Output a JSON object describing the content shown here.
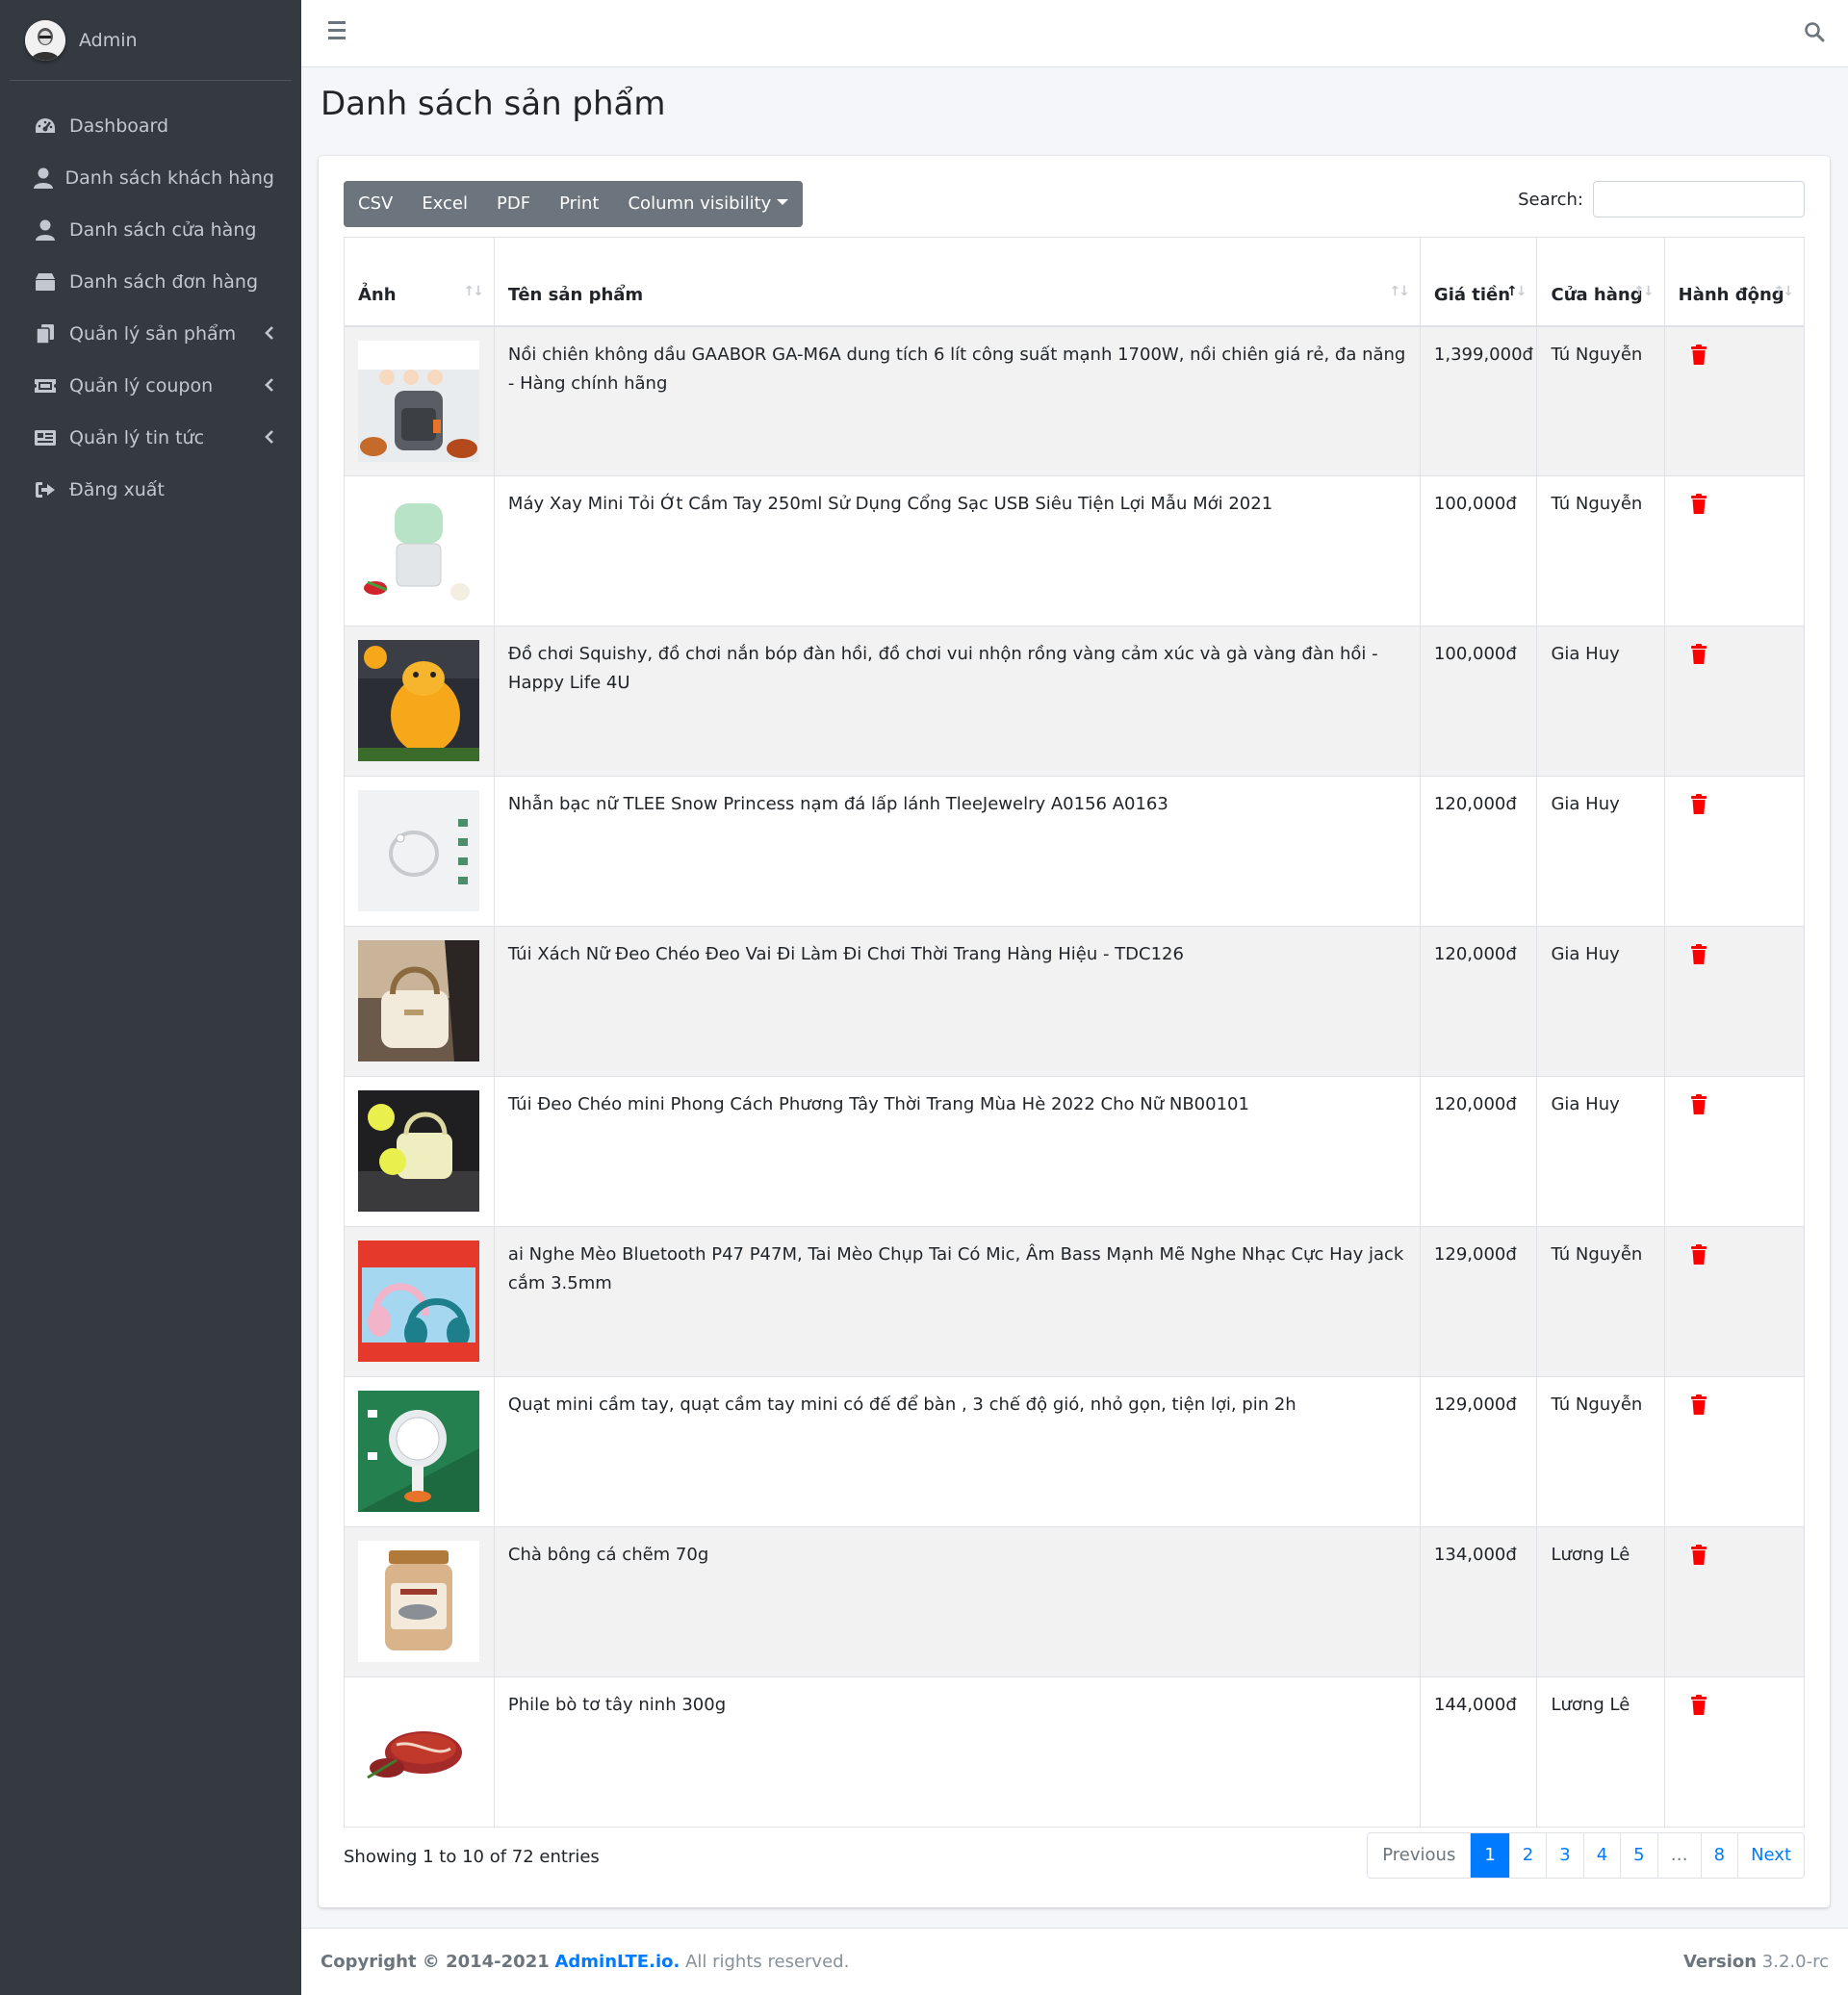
{
  "sidebar": {
    "user_name": "Admin",
    "items": [
      {
        "label": "Dashboard",
        "icon": "tachometer-icon",
        "caret": false
      },
      {
        "label": "Danh sách khách hàng",
        "icon": "user-icon",
        "caret": false
      },
      {
        "label": "Danh sách cửa hàng",
        "icon": "user-icon",
        "caret": false
      },
      {
        "label": "Danh sách đơn hàng",
        "icon": "box-icon",
        "caret": false
      },
      {
        "label": "Quản lý sản phẩm",
        "icon": "copy-icon",
        "caret": true
      },
      {
        "label": "Quản lý coupon",
        "icon": "ticket-icon",
        "caret": true
      },
      {
        "label": "Quản lý tin tức",
        "icon": "newspaper-icon",
        "caret": true
      },
      {
        "label": "Đăng xuất",
        "icon": "sign-out-icon",
        "caret": false
      }
    ]
  },
  "header": {
    "menu_icon": "hamburger-icon",
    "search_icon": "search-icon"
  },
  "page": {
    "title": "Danh sách sản phẩm"
  },
  "toolbar": {
    "buttons": [
      "CSV",
      "Excel",
      "PDF",
      "Print",
      "Column visibility"
    ],
    "search_label": "Search:",
    "search_value": ""
  },
  "table": {
    "columns": [
      "Ảnh",
      "Tên sản phẩm",
      "Giá tiền",
      "Cửa hàng",
      "Hành động"
    ],
    "sorted_column": "Giá tiền",
    "sort_direction": "ascending",
    "rows": [
      {
        "image": "air-fryer-thumbnail",
        "name": "Nồi chiên không dầu GAABOR GA-M6A dung tích 6 lít công suất mạnh 1700W, nồi chiên giá rẻ, đa năng - Hàng chính hãng",
        "price": "1,399,000đ",
        "store": "Tú Nguyễn"
      },
      {
        "image": "mini-blender-thumbnail",
        "name": "Máy Xay Mini Tỏi Ớt Cầm Tay 250ml Sử Dụng Cổng Sạc USB Siêu Tiện Lợi Mẫu Mới 2021",
        "price": "100,000đ",
        "store": "Tú Nguyễn"
      },
      {
        "image": "squishy-toy-thumbnail",
        "name": "Đồ chơi Squishy, đồ chơi nắn bóp đàn hồi, đồ chơi vui nhộn rồng vàng cảm xúc và gà vàng đàn hồi - Happy Life 4U",
        "price": "100,000đ",
        "store": "Gia Huy"
      },
      {
        "image": "silver-ring-thumbnail",
        "name": "Nhẫn bạc nữ TLEE Snow Princess nạm đá lấp lánh TleeJewelry A0156 A0163",
        "price": "120,000đ",
        "store": "Gia Huy"
      },
      {
        "image": "shoulder-bag-thumbnail",
        "name": "Túi Xách Nữ Đeo Chéo Đeo Vai Đi Làm Đi Chơi Thời Trang Hàng Hiệu - TDC126",
        "price": "120,000đ",
        "store": "Gia Huy"
      },
      {
        "image": "crossbody-bag-thumbnail",
        "name": "Túi Đeo Chéo mini Phong Cách Phương Tây Thời Trang Mùa Hè 2022 Cho Nữ NB00101",
        "price": "120,000đ",
        "store": "Gia Huy"
      },
      {
        "image": "cat-headphones-thumbnail",
        "name": "ai Nghe Mèo Bluetooth P47 P47M, Tai Mèo Chụp Tai Có Mic, Âm Bass Mạnh Mẽ Nghe Nhạc Cực Hay jack cắm 3.5mm",
        "price": "129,000đ",
        "store": "Tú Nguyễn"
      },
      {
        "image": "mini-fan-thumbnail",
        "name": "Quạt mini cầm tay, quạt cầm tay mini có đế để bàn , 3 chế độ gió, nhỏ gọn, tiện lợi, pin 2h",
        "price": "129,000đ",
        "store": "Tú Nguyễn"
      },
      {
        "image": "fish-floss-jar-thumbnail",
        "name": "Chà bông cá chẽm 70g",
        "price": "134,000đ",
        "store": "Lương Lê"
      },
      {
        "image": "beef-fillet-thumbnail",
        "name": "Phile bò tơ tây ninh 300g",
        "price": "144,000đ",
        "store": "Lương Lê"
      }
    ],
    "action_icon": "trash-icon",
    "action_color": "#ff0000"
  },
  "footer_info": {
    "showing": "Showing 1 to 10 of 72 entries",
    "pages": [
      "Previous",
      "1",
      "2",
      "3",
      "4",
      "5",
      "…",
      "8",
      "Next"
    ],
    "active_page": "1"
  },
  "footer": {
    "copyright": "Copyright © 2014-2021",
    "brand": "AdminLTE.io.",
    "rights": "All rights reserved.",
    "version_label": "Version",
    "version": "3.2.0-rc"
  },
  "colors": {
    "sidebar_bg": "#343a40",
    "accent": "#007bff",
    "button_bg": "#6c757d",
    "delete": "#ff0000"
  }
}
